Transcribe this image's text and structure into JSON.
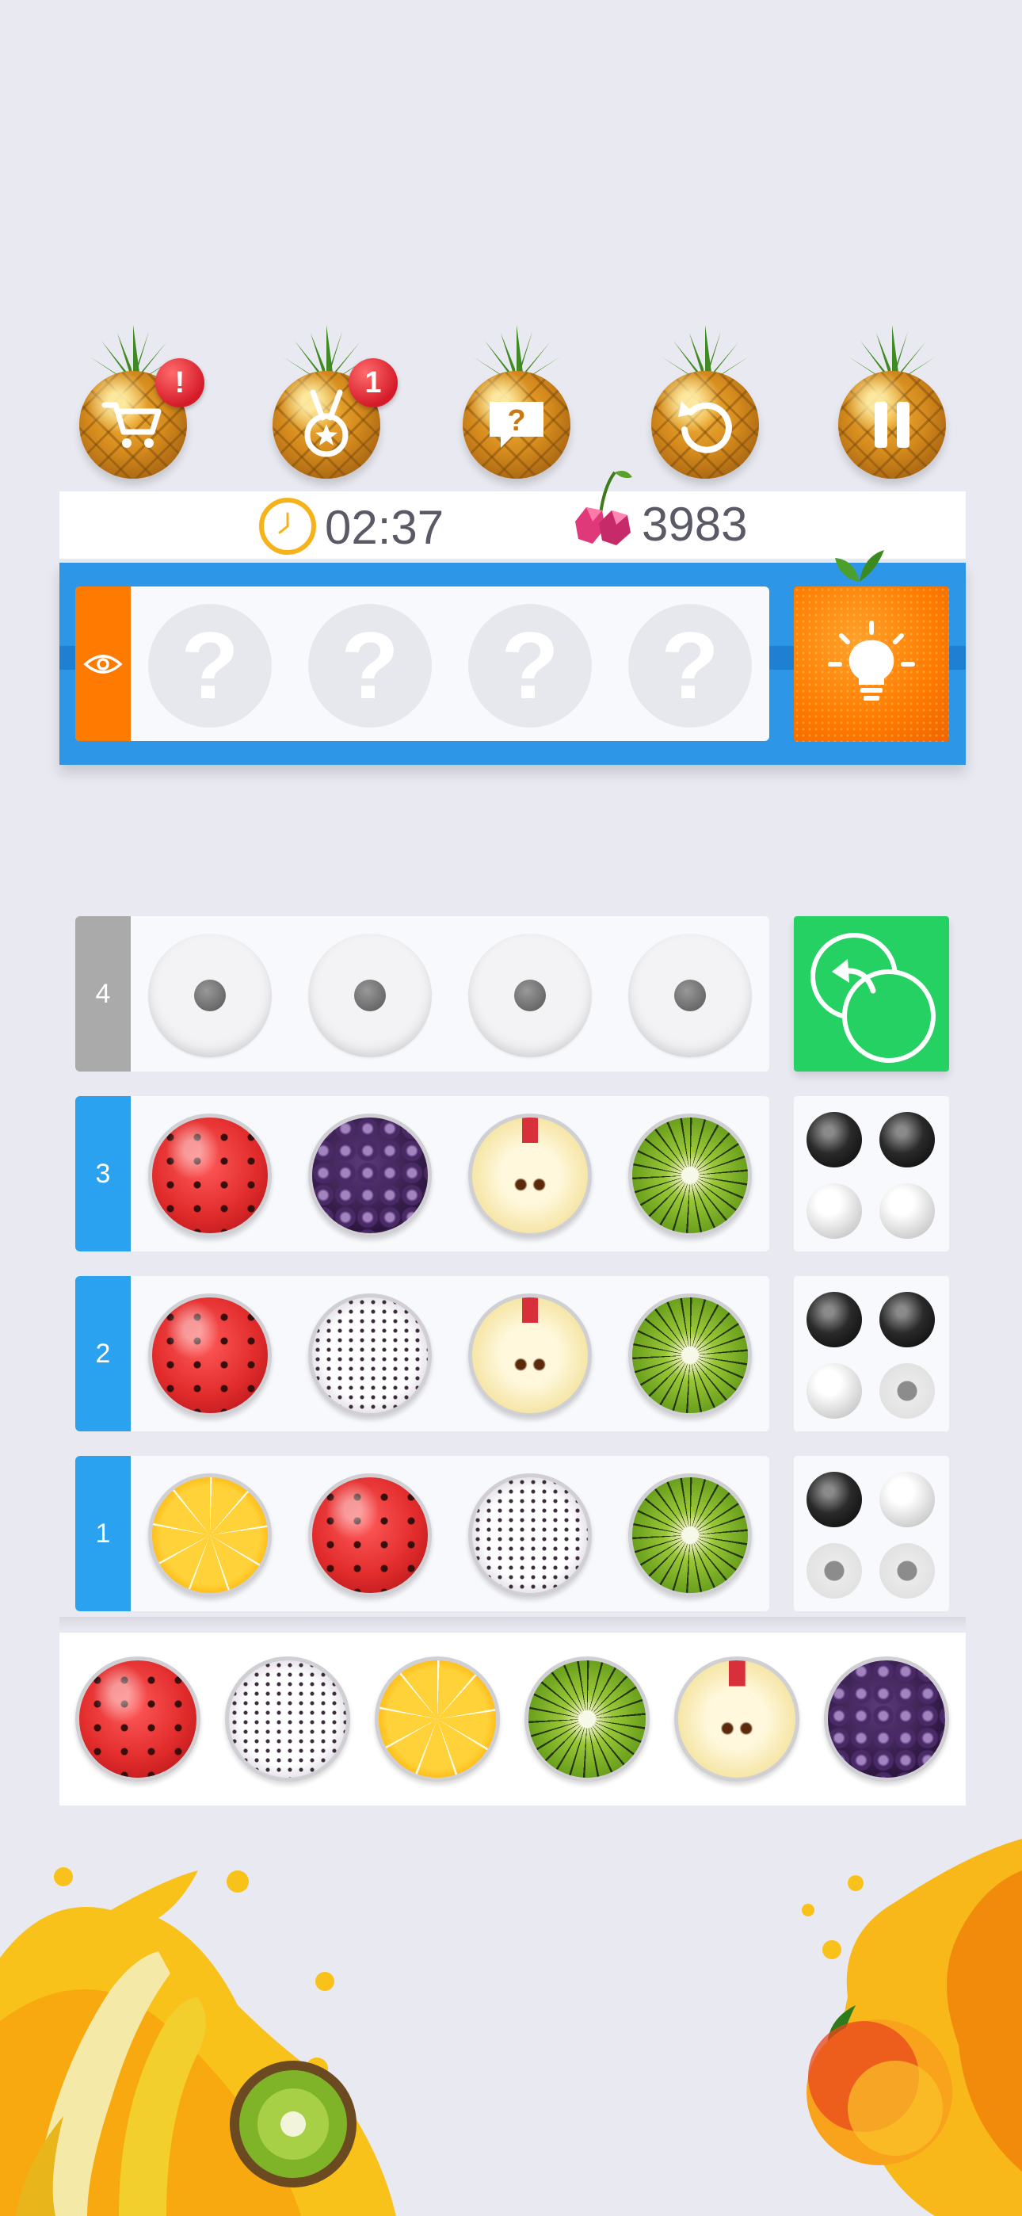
{
  "toolbar": {
    "buttons": [
      {
        "name": "shop",
        "icon": "cart-icon",
        "badge": "!"
      },
      {
        "name": "achievements",
        "icon": "medal-icon",
        "badge": "1"
      },
      {
        "name": "help",
        "icon": "question-bubble-icon",
        "badge": ""
      },
      {
        "name": "restart",
        "icon": "restart-icon",
        "badge": ""
      },
      {
        "name": "pause",
        "icon": "pause-icon",
        "badge": ""
      }
    ]
  },
  "status": {
    "timer": "02:37",
    "score": "3983"
  },
  "secret": {
    "slots": [
      "?",
      "?",
      "?",
      "?"
    ],
    "accent": "#ff7a00"
  },
  "rows": [
    {
      "number": "4",
      "state": "current",
      "fruits": [
        "empty",
        "empty",
        "empty",
        "empty"
      ],
      "feedback": []
    },
    {
      "number": "3",
      "state": "done",
      "fruits": [
        "watermelon",
        "blackberry",
        "apple",
        "kiwi"
      ],
      "feedback": [
        "black",
        "black",
        "white",
        "white"
      ]
    },
    {
      "number": "2",
      "state": "done",
      "fruits": [
        "watermelon",
        "dragonfruit",
        "apple",
        "kiwi"
      ],
      "feedback": [
        "black",
        "black",
        "white",
        "empty"
      ]
    },
    {
      "number": "1",
      "state": "done",
      "fruits": [
        "lemon",
        "watermelon",
        "dragonfruit",
        "kiwi"
      ],
      "feedback": [
        "black",
        "white",
        "empty",
        "empty"
      ]
    }
  ],
  "palette": [
    "watermelon",
    "dragonfruit",
    "lemon",
    "kiwi",
    "apple",
    "blackberry"
  ],
  "colors": {
    "background": "#e9e9f1",
    "row_tab": "#2aa2f0",
    "code_panel": "#2e96e6",
    "undo_button": "#25d162",
    "hint_button": "#ff7a00"
  }
}
